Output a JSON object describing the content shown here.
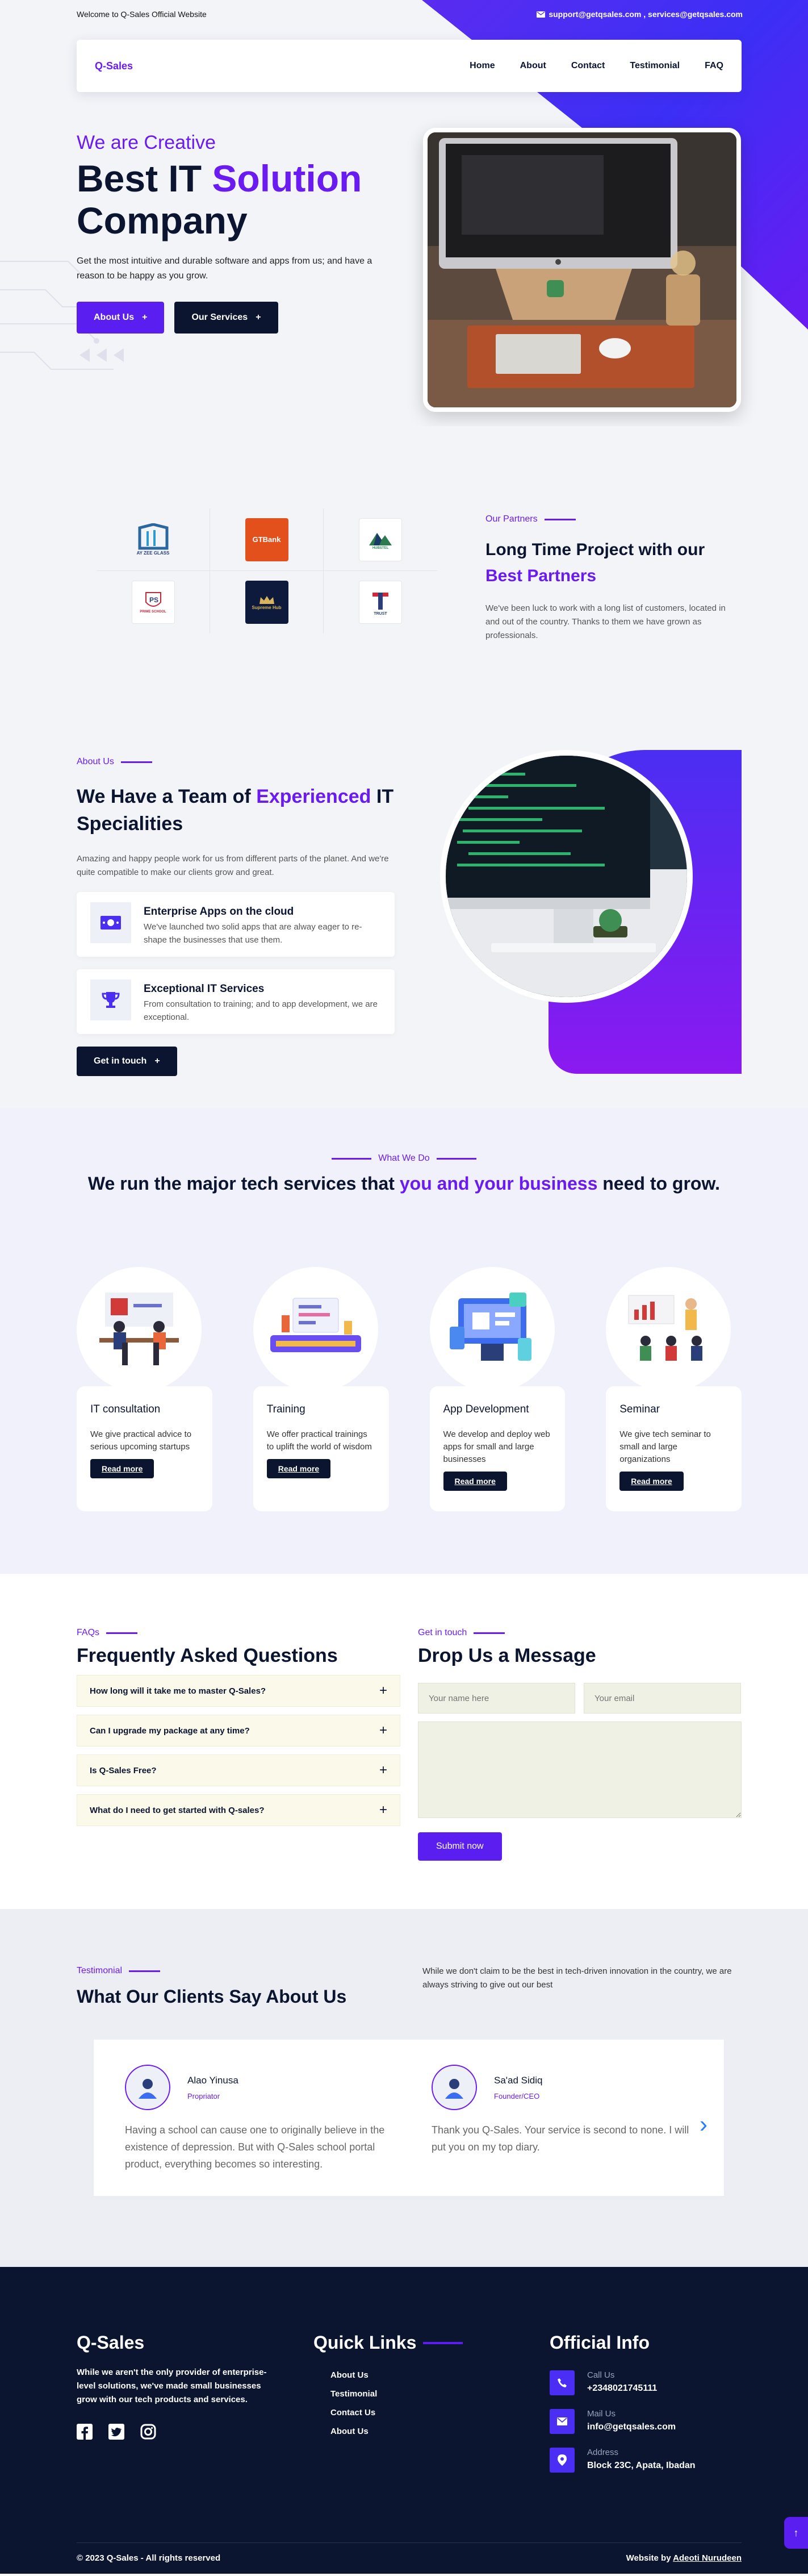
{
  "topbar": {
    "welcome": "Welcome to Q-Sales Official Website",
    "contact": "support@getqsales.com , services@getqsales.com"
  },
  "nav": {
    "logo": "Q-Sales",
    "links": [
      "Home",
      "About",
      "Contact",
      "Testimonial",
      "FAQ"
    ]
  },
  "hero": {
    "kicker": "We are Creative",
    "title_a": "Best IT ",
    "title_b": "Solution",
    "title_c": "Company",
    "desc": "Get the most intuitive and durable software and apps from us; and have a reason to be happy as you grow.",
    "btn_about": "About Us",
    "btn_services": "Our Services"
  },
  "partners": {
    "kicker": "Our Partners",
    "title_a": "Long Time Project with our ",
    "title_b": "Best Partners",
    "desc": "We've been luck to work with a long list of customers, located in and out of the country. Thanks to them we have grown as professionals.",
    "logos": [
      "AY ZEE GLASS",
      "GTBank",
      "HUBSTEL",
      "PRIME SCHOOL",
      "Supreme Hub",
      "TRUST"
    ]
  },
  "about": {
    "kicker": "About Us",
    "title_a": "We Have a Team of ",
    "title_b": "Experienced",
    "title_c": " IT Specialities",
    "intro": "Amazing and happy people work for us from different parts of the planet. And we're quite compatible to make our clients grow and great.",
    "features": [
      {
        "title": "Enterprise Apps on the cloud",
        "desc": "We've launched two solid apps that are alway eager to re-shape the businesses that use them."
      },
      {
        "title": "Exceptional IT Services",
        "desc": "From consultation to training; and to app development, we are exceptional."
      }
    ],
    "cta": "Get in touch"
  },
  "services": {
    "kicker": "What We Do",
    "title_a": "We run the major tech services that ",
    "title_b": "you and your business",
    "title_c": " need to grow.",
    "items": [
      {
        "title": "IT consultation",
        "desc": "We give practical advice to serious upcoming startups",
        "btn": "Read more"
      },
      {
        "title": "Training",
        "desc": "We offer practical trainings to uplift the world of wisdom",
        "btn": "Read more"
      },
      {
        "title": "App Development",
        "desc": "We develop and deploy web apps for small and large businesses",
        "btn": "Read more"
      },
      {
        "title": "Seminar",
        "desc": "We give tech seminar to small and large organizations",
        "btn": "Read more"
      }
    ]
  },
  "faq": {
    "kicker": "FAQs",
    "title": "Frequently Asked Questions",
    "items": [
      "How long will it take me to master Q-Sales?",
      "Can I upgrade my package at any time?",
      "Is Q-Sales Free?",
      "What do I need to get started with Q-sales?"
    ]
  },
  "contact_form": {
    "kicker": "Get in touch",
    "title": "Drop Us a Message",
    "name_placeholder": "Your name here",
    "email_placeholder": "Your email",
    "submit": "Submit now"
  },
  "testimonials": {
    "kicker": "Testimonial",
    "title": "What Our Clients Say About Us",
    "side": "While we don't claim to be the best in tech-driven innovation in the country, we are always striving to give out our best",
    "items": [
      {
        "name": "Alao Yinusa",
        "role": "Propriator",
        "quote": "Having a school can cause one to originally believe in the existence of depression. But with Q-Sales school portal product, everything becomes so interesting."
      },
      {
        "name": "Sa'ad Sidiq",
        "role": "Founder/CEO",
        "quote": "Thank you Q-Sales. Your service is second to none. I will put you on my top diary."
      }
    ]
  },
  "footer": {
    "brand": "Q-Sales",
    "desc": "While we aren't the only provider of enterprise-level solutions, we've made small businesses grow with our tech products and services.",
    "quick_title": "Quick Links",
    "quick_links": [
      "About Us",
      "Testimonial",
      "Contact Us",
      "About Us"
    ],
    "info_title": "Official Info",
    "info": [
      {
        "label": "Call Us",
        "value": "+2348021745111",
        "icon": "phone-icon"
      },
      {
        "label": "Mail Us",
        "value": "info@getqsales.com",
        "icon": "mail-icon"
      },
      {
        "label": "Address",
        "value": "Block 23C, Apata, Ibadan",
        "icon": "location-icon"
      }
    ],
    "copyright": "© 2023 Q-Sales - All rights reserved",
    "credit_prefix": "Website by ",
    "credit_name": "Adeoti Nurudeen"
  }
}
